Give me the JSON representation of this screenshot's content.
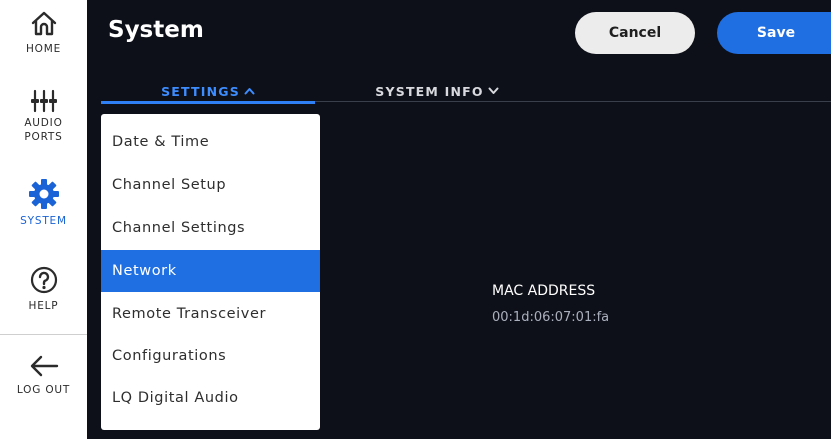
{
  "sidebar": {
    "home": {
      "label": "HOME",
      "icon": "home-icon"
    },
    "audio_ports": {
      "label_line1": "AUDIO",
      "label_line2": "PORTS",
      "icon": "sliders-icon"
    },
    "system": {
      "label": "SYSTEM",
      "icon": "gear-icon",
      "active": true
    },
    "help": {
      "label": "HELP",
      "icon": "help-icon"
    },
    "logout": {
      "label": "LOG OUT",
      "icon": "arrow-left-icon"
    }
  },
  "header": {
    "title": "System",
    "cancel_label": "Cancel",
    "save_label": "Save"
  },
  "tabs": {
    "settings": {
      "label": "SETTINGS",
      "expanded": true
    },
    "system_info": {
      "label": "SYSTEM INFO",
      "expanded": false
    }
  },
  "settings_menu": {
    "items": [
      {
        "label": "Date & Time"
      },
      {
        "label": "Channel Setup"
      },
      {
        "label": "Channel Settings"
      },
      {
        "label": "Network",
        "selected": true
      },
      {
        "label": "Remote Transceiver"
      },
      {
        "label": "Configurations"
      },
      {
        "label": "LQ Digital Audio"
      }
    ]
  },
  "network": {
    "mac_label": "MAC ADDRESS",
    "mac_value": "00:1d:06:07:01:fa"
  },
  "colors": {
    "accent": "#1f6fe3",
    "panel_bg": "#0e1019",
    "sidebar_bg": "#ffffff"
  }
}
